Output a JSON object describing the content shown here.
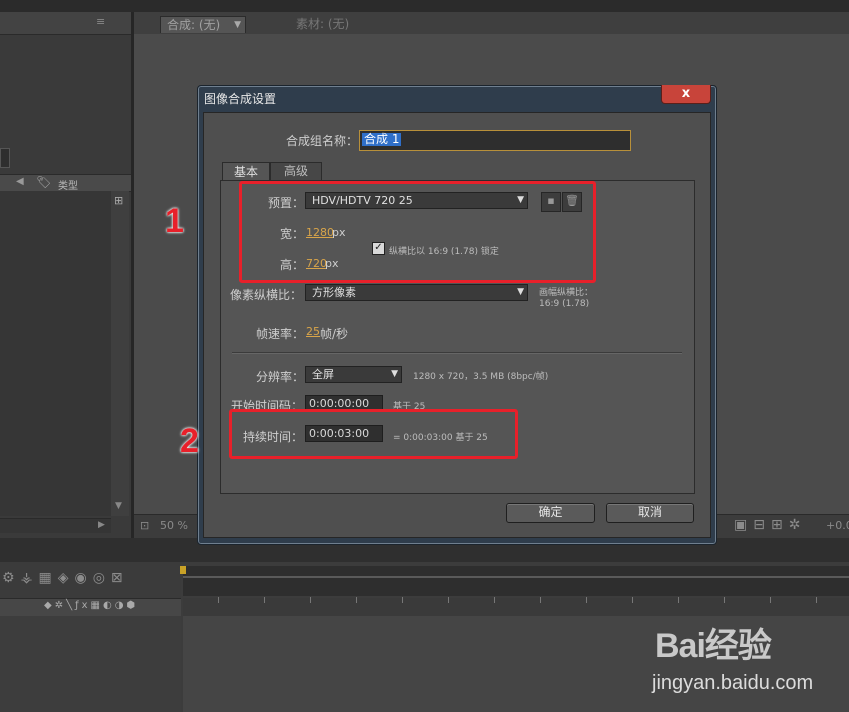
{
  "background": {
    "composition_tab": "合成: (无)",
    "footage_tab": "素材: (无)",
    "project_column_type": "类型",
    "zoom": "50 %",
    "timeline_offset": "+0.0"
  },
  "dialog": {
    "title": "图像合成设置",
    "close_symbol": "x",
    "comp_name_label": "合成组名称：",
    "comp_name_value": "合成 1",
    "tabs": [
      {
        "label": "基本",
        "active": true
      },
      {
        "label": "高级",
        "active": false
      }
    ],
    "preset_label": "预置：",
    "preset_value": "HDV/HDTV 720 25",
    "width_label": "宽：",
    "width_value": "1280",
    "width_unit": "px",
    "height_label": "高：",
    "height_value": "720",
    "height_unit": "px",
    "lock_aspect_checked": true,
    "lock_aspect_label": "纵横比以 16:9 (1.78) 锁定",
    "pixel_aspect_label": "像素纵横比：",
    "pixel_aspect_value": "方形像素",
    "frame_aspect_label": "画幅纵横比：",
    "frame_aspect_value": "16:9 (1.78)",
    "frame_rate_label": "帧速率：",
    "frame_rate_value": "25",
    "frame_rate_unit": "帧/秒",
    "resolution_label": "分辨率：",
    "resolution_value": "全屏",
    "resolution_info": "1280 x 720，3.5 MB (8bpc/帧)",
    "start_timecode_label": "开始时间码：",
    "start_timecode_value": "0:00:00:00",
    "start_timecode_base": "基于 25",
    "duration_label": "持续时间：",
    "duration_value": "0:00:03:00",
    "duration_info": "= 0:00:03:00  基于 25",
    "ok_label": "确定",
    "cancel_label": "取消"
  },
  "annotations": {
    "marker_1": "1",
    "marker_2": "2",
    "highlight_color": "#e8202a"
  },
  "watermark": {
    "logo": "Bai经验",
    "url": "jingyan.baidu.com"
  }
}
